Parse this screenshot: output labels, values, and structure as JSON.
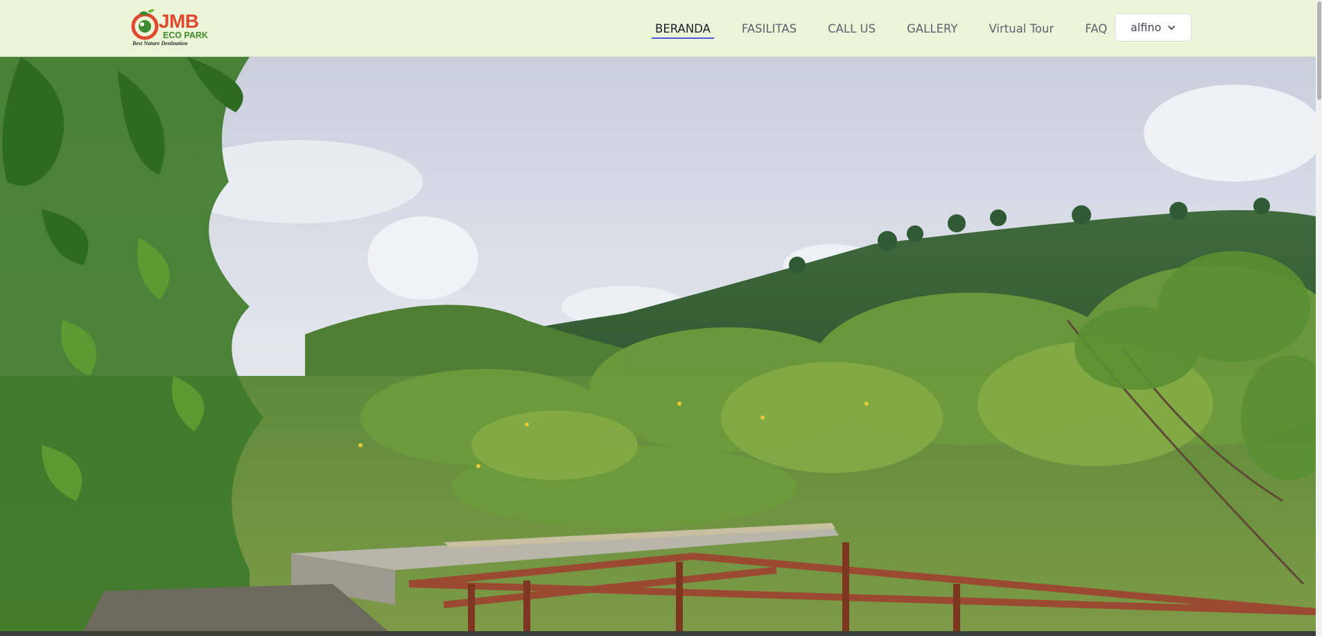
{
  "brand": {
    "name_primary": "JMB",
    "name_secondary": "ECO PARK",
    "tagline": "Best Nature Destination"
  },
  "nav": {
    "items": [
      {
        "label": "BERANDA",
        "active": true
      },
      {
        "label": "FASILITAS",
        "active": false
      },
      {
        "label": "CALL US",
        "active": false
      },
      {
        "label": "GALLERY",
        "active": false
      },
      {
        "label": "Virtual Tour",
        "active": false
      },
      {
        "label": "FAQ",
        "active": false
      }
    ]
  },
  "user_menu": {
    "username": "alfino",
    "icon": "chevron-down-icon"
  },
  "hero": {
    "image_subject": "hero-photo"
  },
  "colors": {
    "navbar_bg": "#ebf5d7",
    "active_underline": "#4f54d6",
    "logo_red": "#e0492f",
    "logo_green": "#3f8a2f"
  }
}
